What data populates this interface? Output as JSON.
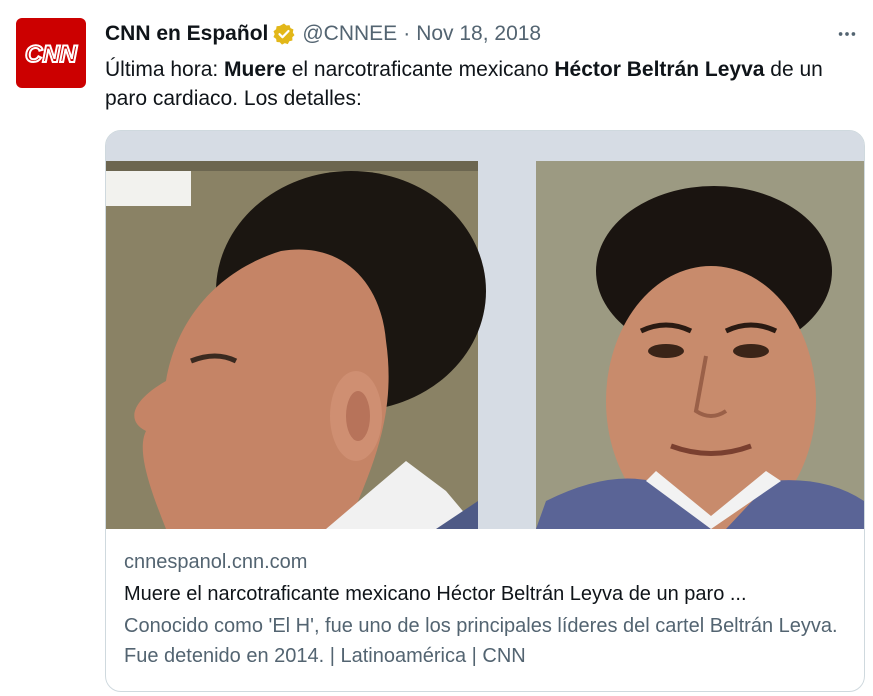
{
  "tweet": {
    "author_name": "CNN en Español",
    "handle": "@CNNEE",
    "separator": "·",
    "date": "Nov 18, 2018",
    "verified": true,
    "avatar_text": "CNN",
    "text_parts": [
      {
        "text": "Última hora: ",
        "bold": false,
        "id": "t1"
      },
      {
        "text": "Muere",
        "bold": true,
        "id": "t2"
      },
      {
        "text": " el narcotraficante mexicano ",
        "bold": false,
        "id": "t3"
      },
      {
        "text": "Héctor Beltrán Leyva",
        "bold": true,
        "id": "t4"
      },
      {
        "text": " de un paro cardiaco. Los detalles:",
        "bold": false,
        "id": "t5"
      }
    ],
    "more_icon": "ellipsis-icon"
  },
  "card": {
    "domain": "cnnespanol.cnn.com",
    "title": "Muere el narcotraficante mexicano Héctor Beltrán Leyva de un paro ...",
    "description": "Conocido como 'El H', fue uno de los principales líderes del cartel Beltrán Leyva. Fue detenido en 2014. | Latinoamérica | CNN"
  },
  "colors": {
    "brand_red": "#cc0000",
    "verified_gold": "#e2b719",
    "secondary_text": "#536471",
    "border": "#cfd9de"
  }
}
